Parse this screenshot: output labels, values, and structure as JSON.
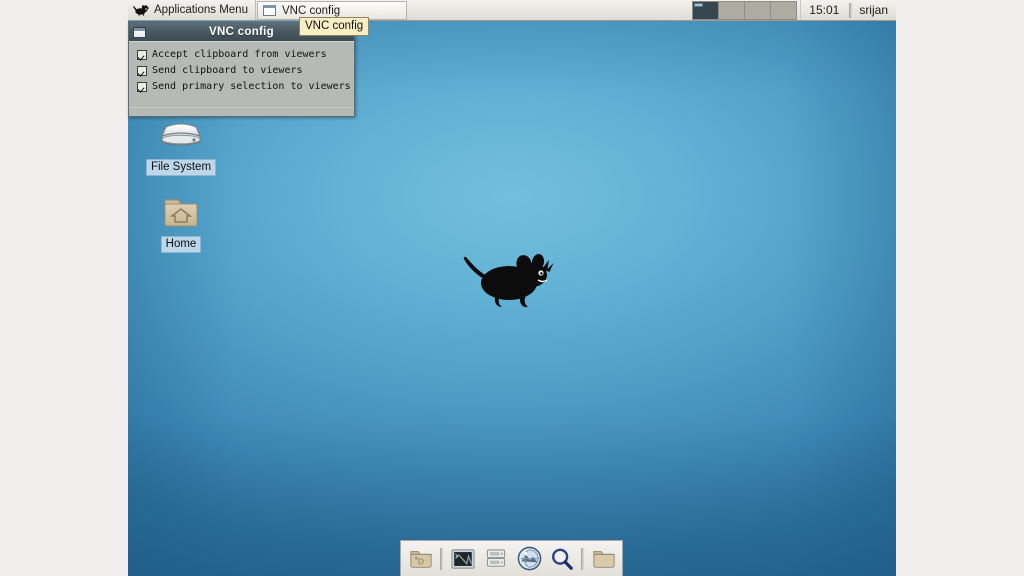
{
  "panel": {
    "apps_menu": {
      "label": "Applications Menu",
      "icon": "xfce-mouse-icon"
    },
    "tasks": [
      {
        "label": "VNC config",
        "icon": "window-icon",
        "active": true
      }
    ],
    "workspaces": [
      {
        "name": "workspace-1",
        "active": true
      },
      {
        "name": "workspace-2",
        "active": false
      },
      {
        "name": "workspace-3",
        "active": false
      },
      {
        "name": "workspace-4",
        "active": false
      }
    ],
    "clock": "15:01",
    "user": "srijan"
  },
  "tooltip": {
    "text": "VNC config"
  },
  "vnc_window": {
    "title": "VNC config",
    "titlebar_color": "#49585f",
    "body_color": "#b6bab6",
    "options": [
      {
        "label": "Accept clipboard from viewers",
        "checked": true
      },
      {
        "label": "Send clipboard to viewers",
        "checked": true
      },
      {
        "label": "Send primary selection to viewers",
        "checked": true
      }
    ]
  },
  "desktop": {
    "wallpaper_color": "#4e9dc6",
    "logo": "xfce-mouse-logo",
    "icons": [
      {
        "label": "File System",
        "icon": "hard-drive-icon"
      },
      {
        "label": "Home",
        "icon": "home-folder-icon"
      }
    ]
  },
  "dock": {
    "items": [
      {
        "name": "show-desktop-icon",
        "label": "Show Desktop"
      },
      {
        "name": "terminal-icon",
        "label": "Terminal Emulator"
      },
      {
        "name": "file-manager-icon",
        "label": "File Manager"
      },
      {
        "name": "web-browser-icon",
        "label": "Web Browser"
      },
      {
        "name": "search-icon",
        "label": "Find Files"
      },
      {
        "name": "folder-icon",
        "label": "Folder"
      }
    ]
  }
}
